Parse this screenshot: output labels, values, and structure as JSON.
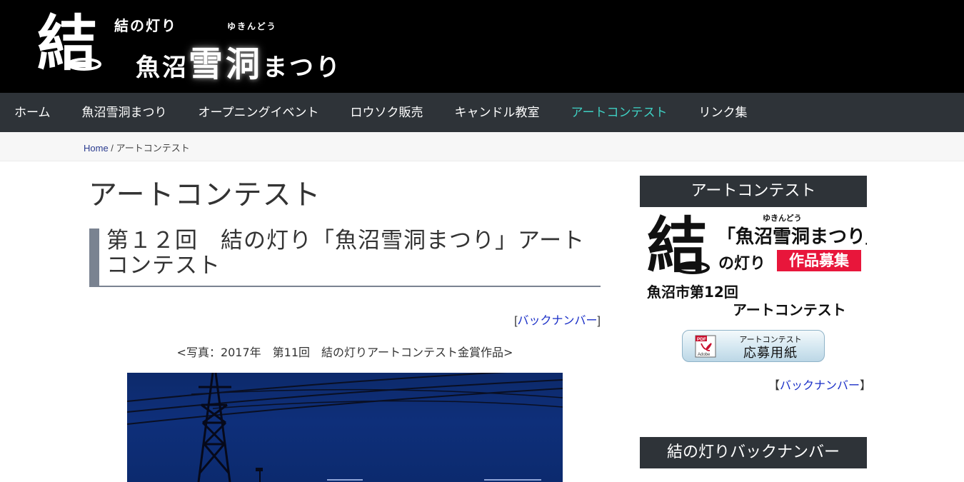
{
  "header": {
    "logo_kanji": "結",
    "logo_small": "結の灯り",
    "logo_ruby": "ゆきんどう",
    "logo_main_a": "魚沼",
    "logo_main_b": "雪洞",
    "logo_main_c": "まつり"
  },
  "nav": {
    "items": [
      {
        "label": "ホーム"
      },
      {
        "label": "魚沼雪洞まつり"
      },
      {
        "label": "オープニングイベント"
      },
      {
        "label": "ロウソク販売"
      },
      {
        "label": "キャンドル教室"
      },
      {
        "label": "アートコンテスト"
      },
      {
        "label": "リンク集"
      }
    ],
    "active_color": "#3fd1c4"
  },
  "breadcrumb": {
    "home": "Home",
    "separator": " / ",
    "current": "アートコンテスト"
  },
  "main": {
    "page_title": "アートコンテスト",
    "heading_line1": "第１２回　結の灯り「魚沼雪洞まつり」アート",
    "heading_line2": "コンテスト",
    "back_number": {
      "open": "[",
      "label": "バックナンバー",
      "close": "]"
    },
    "photo_caption": "<写真：2017年　第11回　結の灯りアートコンテスト金賞作品>"
  },
  "sidebar": {
    "widget1_title": "アートコンテスト",
    "banner": {
      "ruby": "ゆきんどう",
      "line1": "「魚沼雪洞まつり」",
      "line2": "の灯り",
      "badge": "作品募集",
      "line3": "魚沼市第12回",
      "line4": "アートコンテスト"
    },
    "pdf_button": {
      "pdf_label": "PDF",
      "adobe_label": "Adobe",
      "small": "アートコンテスト",
      "large": "応募用紙"
    },
    "back_number": {
      "open": "【",
      "label": "バックナンバー",
      "close": "】"
    },
    "widget2_title": "結の灯りバックナンバー"
  }
}
